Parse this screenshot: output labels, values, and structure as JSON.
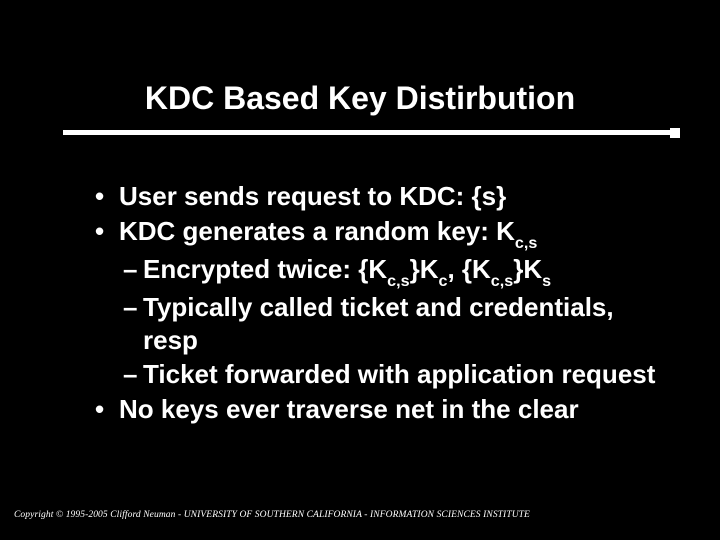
{
  "title": "KDC Based Key Distirbution",
  "bullets": {
    "b1_pre": "User sends request to KDC: {s}",
    "b2_pre": "KDC generates a random key: K",
    "b2_sub": "c,s",
    "d1_a": "Encrypted twice: {K",
    "d1_s1": "c,s",
    "d1_b": "}K",
    "d1_s2": "c",
    "d1_c": ", {K",
    "d1_s3": "c,s",
    "d1_d": "}K",
    "d1_s4": "s",
    "d2": "Typically called ticket and credentials, resp",
    "d3": "Ticket forwarded with application request",
    "b3": "No keys ever traverse net in the clear"
  },
  "footer": "Copyright © 1995-2005 Clifford Neuman - UNIVERSITY OF SOUTHERN CALIFORNIA - INFORMATION SCIENCES INSTITUTE"
}
